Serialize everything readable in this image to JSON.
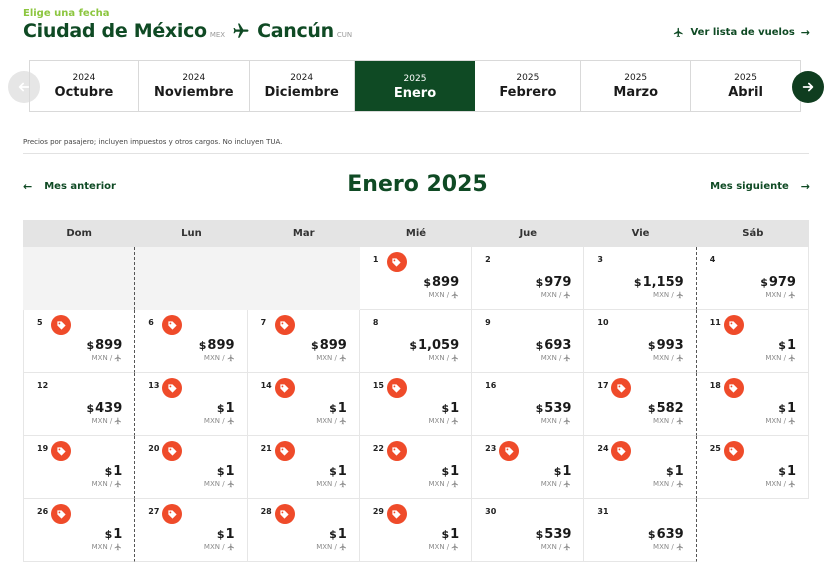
{
  "header": {
    "subtitle": "Elige una fecha",
    "origin_city": "Ciudad de México",
    "origin_code": "MEX",
    "destination_city": "Cancún",
    "destination_code": "CUN",
    "flights_link": "Ver lista de vuelos"
  },
  "months": [
    {
      "year": "2024",
      "month": "Octubre",
      "active": false
    },
    {
      "year": "2024",
      "month": "Noviembre",
      "active": false
    },
    {
      "year": "2024",
      "month": "Diciembre",
      "active": false
    },
    {
      "year": "2025",
      "month": "Enero",
      "active": true
    },
    {
      "year": "2025",
      "month": "Febrero",
      "active": false
    },
    {
      "year": "2025",
      "month": "Marzo",
      "active": false
    },
    {
      "year": "2025",
      "month": "Abril",
      "active": false
    }
  ],
  "note": "Precios por pasajero; incluyen impuestos y otros cargos. No incluyen TUA.",
  "calendar": {
    "prev_label": "Mes anterior",
    "next_label": "Mes siguiente",
    "title": "Enero 2025",
    "weekdays": [
      "Dom",
      "Lun",
      "Mar",
      "Mié",
      "Jue",
      "Vie",
      "Sáb"
    ],
    "currency_symbol": "$",
    "meta_label": "MXN /",
    "leading_blank_days": 3,
    "days": [
      {
        "day": "1",
        "price": "899",
        "deal": true
      },
      {
        "day": "2",
        "price": "979",
        "deal": false
      },
      {
        "day": "3",
        "price": "1,159",
        "deal": false
      },
      {
        "day": "4",
        "price": "979",
        "deal": false
      },
      {
        "day": "5",
        "price": "899",
        "deal": true
      },
      {
        "day": "6",
        "price": "899",
        "deal": true
      },
      {
        "day": "7",
        "price": "899",
        "deal": true
      },
      {
        "day": "8",
        "price": "1,059",
        "deal": false
      },
      {
        "day": "9",
        "price": "693",
        "deal": false
      },
      {
        "day": "10",
        "price": "993",
        "deal": false
      },
      {
        "day": "11",
        "price": "1",
        "deal": true
      },
      {
        "day": "12",
        "price": "439",
        "deal": false
      },
      {
        "day": "13",
        "price": "1",
        "deal": true
      },
      {
        "day": "14",
        "price": "1",
        "deal": true
      },
      {
        "day": "15",
        "price": "1",
        "deal": true
      },
      {
        "day": "16",
        "price": "539",
        "deal": false
      },
      {
        "day": "17",
        "price": "582",
        "deal": true
      },
      {
        "day": "18",
        "price": "1",
        "deal": true
      },
      {
        "day": "19",
        "price": "1",
        "deal": true
      },
      {
        "day": "20",
        "price": "1",
        "deal": true
      },
      {
        "day": "21",
        "price": "1",
        "deal": true
      },
      {
        "day": "22",
        "price": "1",
        "deal": true
      },
      {
        "day": "23",
        "price": "1",
        "deal": true
      },
      {
        "day": "24",
        "price": "1",
        "deal": true
      },
      {
        "day": "25",
        "price": "1",
        "deal": true
      },
      {
        "day": "26",
        "price": "1",
        "deal": true
      },
      {
        "day": "27",
        "price": "1",
        "deal": true
      },
      {
        "day": "28",
        "price": "1",
        "deal": true
      },
      {
        "day": "29",
        "price": "1",
        "deal": true
      },
      {
        "day": "30",
        "price": "539",
        "deal": false
      },
      {
        "day": "31",
        "price": "639",
        "deal": false
      }
    ]
  },
  "colors": {
    "brand_dark": "#0f4a24",
    "brand_light": "#8cc63f",
    "deal_tag": "#ef4b2a"
  },
  "icons": {
    "route": "plane-icon",
    "flights_link": "plane-icon",
    "prev": "arrow-left-icon",
    "next": "arrow-right-icon",
    "deal": "price-tag-icon"
  }
}
